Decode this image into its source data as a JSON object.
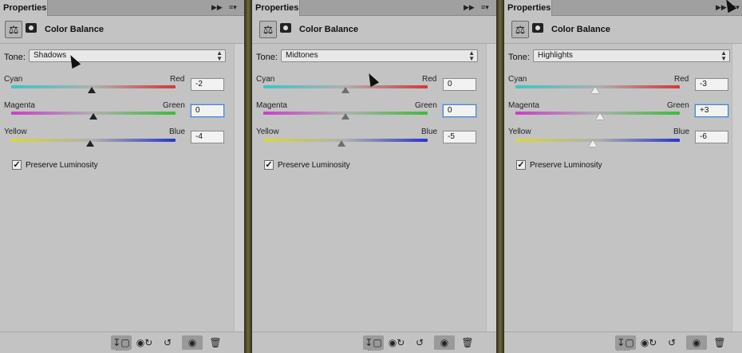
{
  "panels": [
    {
      "tab_label": "Properties",
      "tab_controls": "▶▶",
      "menu_icon": "menu-icon",
      "title": "Color Balance",
      "tone_label": "Tone:",
      "tone_value": "Shadows",
      "sliders": [
        {
          "left": "Cyan",
          "right": "Red",
          "value": "-2",
          "level": -2
        },
        {
          "left": "Magenta",
          "right": "Green",
          "value": "0",
          "level": 0
        },
        {
          "left": "Yellow",
          "right": "Blue",
          "value": "-4",
          "level": -4
        }
      ],
      "preserve_label": "Preserve Luminosity",
      "preserve_checked": true
    },
    {
      "tab_label": "Properties",
      "tab_controls": "▶▶",
      "menu_icon": "menu-icon",
      "title": "Color Balance",
      "tone_label": "Tone:",
      "tone_value": "Midtones",
      "sliders": [
        {
          "left": "Cyan",
          "right": "Red",
          "value": "0",
          "level": 0
        },
        {
          "left": "Magenta",
          "right": "Green",
          "value": "0",
          "level": 0
        },
        {
          "left": "Yellow",
          "right": "Blue",
          "value": "-5",
          "level": -5
        }
      ],
      "preserve_label": "Preserve Luminosity",
      "preserve_checked": true
    },
    {
      "tab_label": "Properties",
      "tab_controls": "▶▶",
      "menu_icon": "menu-icon",
      "title": "Color Balance",
      "tone_label": "Tone:",
      "tone_value": "Highlights",
      "sliders": [
        {
          "left": "Cyan",
          "right": "Red",
          "value": "-3",
          "level": -3
        },
        {
          "left": "Magenta",
          "right": "Green",
          "value": "+3",
          "level": 3
        },
        {
          "left": "Yellow",
          "right": "Blue",
          "value": "-6",
          "level": -6
        }
      ],
      "preserve_label": "Preserve Luminosity",
      "preserve_checked": true
    }
  ],
  "footer_icons": [
    "clip-to-layer-icon",
    "view-previous-icon",
    "reset-icon",
    "visibility-eye-icon",
    "trash-icon"
  ],
  "colors": {
    "panel_bg": "#c3c3c3",
    "focus_border": "#4f83c4",
    "divider_gold": "#6e6a3a"
  }
}
